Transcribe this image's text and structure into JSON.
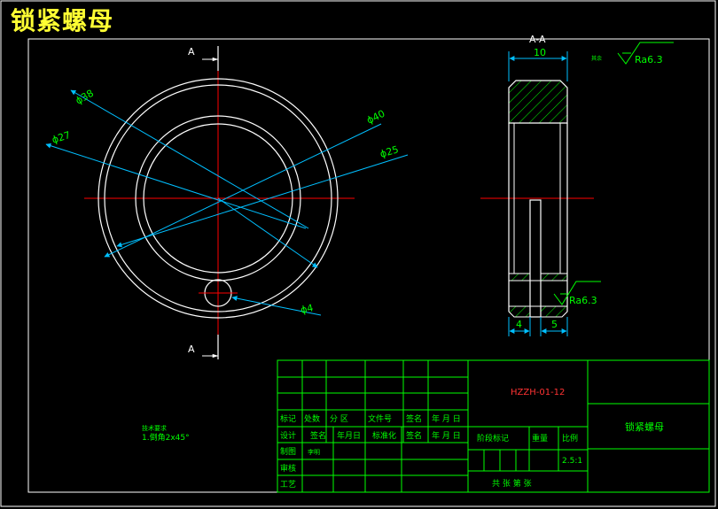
{
  "title": "锁紧螺母",
  "section_label": "A-A",
  "view_marker": "A",
  "dimensions": {
    "dia_38": "ϕ38",
    "dia_40": "ϕ40",
    "dia_27": "ϕ27",
    "dia_25": "ϕ25",
    "dia_4": "ϕ4",
    "width_10": "10",
    "width_4": "4",
    "width_5": "5"
  },
  "roughness": {
    "top_prefix": "其余",
    "top": "Ra6.3",
    "side": "Ra6.3"
  },
  "note": {
    "heading": "技术要求",
    "text": "1.倒角2x45°"
  },
  "title_block": {
    "drawing_no": "HZZH-01-12",
    "part_name": "锁紧螺母",
    "scale": "2.5:1",
    "row1": [
      "标记",
      "处数",
      "分 区",
      "文件号",
      "签名",
      "年 月 日"
    ],
    "row2": [
      "设计",
      "签名",
      "年月日",
      "标准化",
      "签名",
      "年 月 日"
    ],
    "stage_mark": "阶段标记",
    "weight": "重量",
    "ratio": "比例",
    "drafter": "制图",
    "drafter_name": "李明",
    "reviewer": "审核",
    "process": "工艺",
    "sheets": "共   张  第   张"
  },
  "colors": {
    "outline": "#ffffff",
    "frame": "#00ff00",
    "center": "#ff0000",
    "dimension": "#00bfff",
    "text": "#00ff00",
    "title_text": "#ffff33",
    "drawing_no": "#ff3333"
  }
}
